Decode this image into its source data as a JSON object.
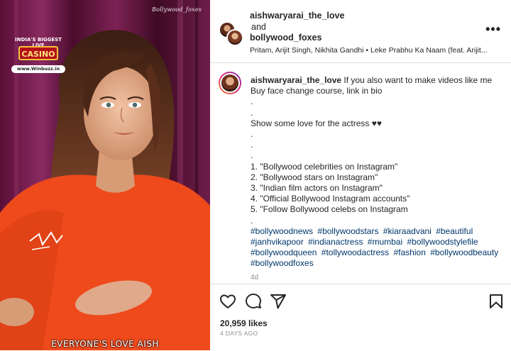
{
  "media": {
    "watermark": "Bollywood_foxes",
    "caption": "EVERYONE'S LOVE AISH",
    "ad_badge": {
      "top_text": "INDIA'S BIGGEST LIVE",
      "main_text": "CASINO",
      "url": "www.Winbuzz.in"
    }
  },
  "header": {
    "user1": "aishwaryarai_the_love",
    "and_text": "and",
    "user2": "bollywood_foxes",
    "audio": "Pritam, Arijit Singh, Nikhita Gandhi • Leke Prabhu Ka Naam (feat. Arijit...",
    "more_label": "•••"
  },
  "caption": {
    "username": "aishwaryarai_the_love",
    "first_line": " If you also want to make videos like me",
    "lines": [
      "Buy face change course, link in bio",
      ".",
      ".",
      "Show some love for the actress ♥♥",
      ".",
      ".",
      ".",
      "1. \"Bollywood celebrities on Instagram\"",
      "2. \"Bollywood stars on Instagram\"",
      "3. \"Indian film actors on Instagram\"",
      "4. \"Official Bollywood Instagram accounts\"",
      "5. \"Follow Bollywood celebs on Instagram",
      "."
    ],
    "hashtags": [
      "#bollywoodnews",
      "#bollywoodstars",
      "#kiaraadvani",
      "#beautiful",
      "#janhvikapoor",
      "#indianactress",
      "#mumbai",
      "#bollywoodstylefile",
      "#bollywoodqueen",
      "#tollywoodactress",
      "#fashion",
      "#bollywoodbeauty",
      "#bollywoodfoxes"
    ],
    "age": "4d"
  },
  "footer": {
    "likes": "20,959 likes",
    "date": "4 DAYS AGO"
  },
  "icons": {
    "like": "heart-icon",
    "comment": "comment-icon",
    "share": "share-icon",
    "save": "bookmark-icon"
  },
  "colors": {
    "text": "#262626",
    "hashtag": "#00376b",
    "muted": "#8e8e8e",
    "shirt": "#ee4a1c"
  }
}
